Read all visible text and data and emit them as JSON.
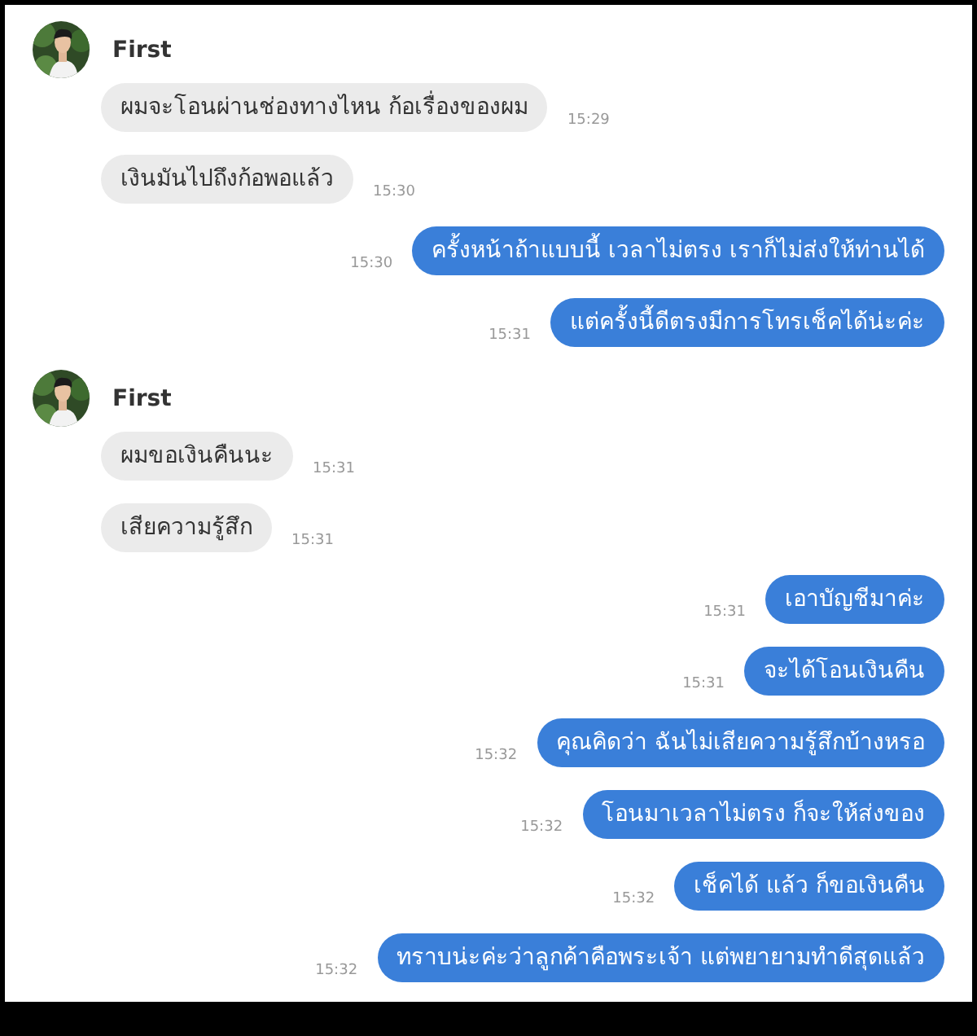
{
  "groups": [
    {
      "kind": "incoming",
      "sender": "First",
      "messages": [
        {
          "text": "ผมจะโอนผ่านช่องทางไหน ก้อเรื่องของผม",
          "time": "15:29"
        },
        {
          "text": "เงินมันไปถึงก้อพอแล้ว",
          "time": "15:30"
        }
      ]
    },
    {
      "kind": "outgoing",
      "messages": [
        {
          "text": "ครั้งหน้าถ้าแบบนี้ เวลาไม่ตรง เราก็ไม่ส่งให้ท่านได้",
          "time": "15:30"
        },
        {
          "text": "แต่ครั้งนี้ดีตรงมีการโทรเช็คได้น่ะค่ะ",
          "time": "15:31"
        }
      ]
    },
    {
      "kind": "incoming",
      "sender": "First",
      "messages": [
        {
          "text": "ผมขอเงินคืนนะ",
          "time": "15:31"
        },
        {
          "text": "เสียความรู้สึก",
          "time": "15:31"
        }
      ]
    },
    {
      "kind": "outgoing",
      "messages": [
        {
          "text": "เอาบัญชีมาค่ะ",
          "time": "15:31"
        },
        {
          "text": "จะได้โอนเงินคืน",
          "time": "15:31"
        },
        {
          "text": "คุณคิดว่า ฉันไม่เสียความรู้สึกบ้างหรอ",
          "time": "15:32"
        },
        {
          "text": "โอนมาเวลาไม่ตรง ก็จะให้ส่งของ",
          "time": "15:32"
        },
        {
          "text": "เช็คได้ แล้ว ก็ขอเงินคืน",
          "time": "15:32"
        },
        {
          "text": "ทราบน่ะค่ะว่าลูกค้าคือพระเจ้า แต่พยายามทำดีสุดแล้ว",
          "time": "15:32"
        }
      ]
    }
  ]
}
